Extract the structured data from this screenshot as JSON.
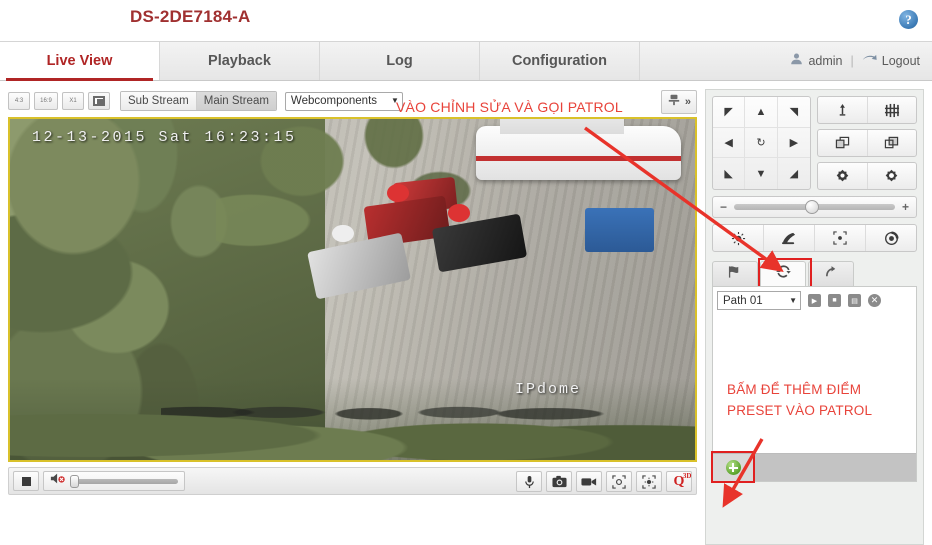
{
  "header": {
    "device_model": "DS-2DE7184-A",
    "help_icon": "help-icon",
    "help_label": "?"
  },
  "tabs": [
    {
      "label": "Live View",
      "active": true
    },
    {
      "label": "Playback",
      "active": false
    },
    {
      "label": "Log",
      "active": false
    },
    {
      "label": "Configuration",
      "active": false
    }
  ],
  "user": {
    "user_icon": "user-icon",
    "name": "admin",
    "separator": "|",
    "logout_icon": "logout-icon",
    "logout_label": "Logout"
  },
  "player_toolbar": {
    "aspect_4_3": "4:3",
    "aspect_16_9": "16:9",
    "aspect_x1": "X1",
    "fullscreen_icon": "fullscreen-icon",
    "sub_stream": "Sub Stream",
    "main_stream": "Main Stream",
    "plugin_selected": "Webcomponents",
    "plugin_caret": "▼",
    "ptz_expand_icon": "ptz-icon",
    "ptz_expand_chevron": "»"
  },
  "video": {
    "osd_timestamp": "12-13-2015 Sat 16:23:15",
    "osd_camera_name": "IPdome"
  },
  "player_bottom": {
    "stop_icon": "stop-icon",
    "volume_icon": "volume-mute-icon",
    "volume_value": 0,
    "audio_icon": "microphone-icon",
    "capture_icon": "snapshot-camera-icon",
    "record_icon": "video-record-icon",
    "zoom_icon": "zoom-focus-icon",
    "lens_icon": "lens-initialization-icon",
    "q3d_label": "Q",
    "q3d_sup": "3D"
  },
  "ptz": {
    "dpad": {
      "up_left": "◤",
      "up": "▲",
      "up_right": "◥",
      "left": "◀",
      "auto_scan": "↻",
      "right": "▶",
      "down_left": "◣",
      "down": "▼",
      "down_right": "◢"
    },
    "zoom_buttons": [
      {
        "name": "zoom-in-icon",
        "label": "♠"
      },
      {
        "name": "zoom-out-icon",
        "label": "⌗"
      },
      {
        "name": "focus-near-icon",
        "label": "▣"
      },
      {
        "name": "focus-far-icon",
        "label": "▢"
      },
      {
        "name": "iris-plus-icon",
        "label": "✛"
      },
      {
        "name": "iris-minus-icon",
        "label": "✚"
      }
    ],
    "speed": {
      "minus": "−",
      "plus": "+",
      "value": 44
    },
    "aux_buttons": [
      {
        "name": "light-icon"
      },
      {
        "name": "wiper-icon"
      },
      {
        "name": "auto-focus-icon"
      },
      {
        "name": "lens-init-icon"
      }
    ],
    "pp_tabs": [
      {
        "name": "preset-tab",
        "icon": "flag-icon",
        "active": false
      },
      {
        "name": "patrol-tab",
        "icon": "patrol-cycle-icon",
        "active": true
      },
      {
        "name": "pattern-tab",
        "icon": "pattern-arrow-icon",
        "active": false
      }
    ],
    "path": {
      "selected": "Path 01",
      "caret": "▼",
      "buttons": [
        {
          "name": "start-patrol-button",
          "icon": "play-icon",
          "glyph": "▶"
        },
        {
          "name": "stop-patrol-button",
          "icon": "stop-icon",
          "glyph": "■"
        },
        {
          "name": "save-patrol-button",
          "icon": "save-icon",
          "glyph": "▤"
        },
        {
          "name": "delete-patrol-button",
          "icon": "delete-icon",
          "glyph": "✕"
        }
      ]
    },
    "add_button": {
      "name": "add-preset-to-patrol-button",
      "icon": "green-plus-icon"
    }
  },
  "annotations": {
    "top_note": "VÀO CHỈNH SỬA VÀ GỌI PATROL",
    "bottom_note_line1": "BẤM ĐỂ THÊM ĐIỂM",
    "bottom_note_line2": "PRESET VÀO PATROL",
    "highlight_color": "#e8433a",
    "box_color": "#e02020"
  }
}
